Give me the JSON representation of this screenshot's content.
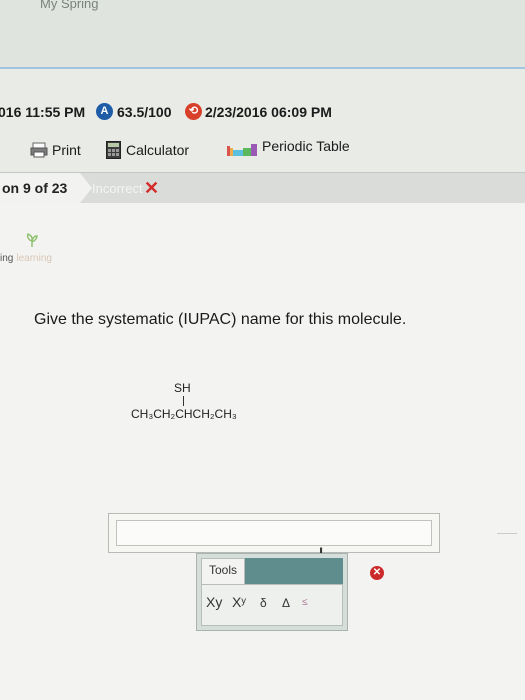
{
  "header": {
    "fragment": "My Spring"
  },
  "status": {
    "due_time": "016 11:55 PM",
    "score_icon": "A",
    "score": "63.5/100",
    "history_icon": "clock-arrow-icon",
    "submitted": "2/23/2016 06:09 PM"
  },
  "toolbar": {
    "print_label": "Print",
    "calculator_label": "Calculator",
    "periodic_label": "Periodic Table"
  },
  "question_bar": {
    "number": "on 9 of 23",
    "status_text": "Incorrect",
    "status_mark": "✕"
  },
  "brand": {
    "part1": "ing",
    "part2": "learning"
  },
  "question": {
    "prompt": "Give the systematic (IUPAC) name for this molecule.",
    "sh_label": "SH",
    "chain": "CH₃CH₂CHCH₂CH₃"
  },
  "answer": {
    "value": ""
  },
  "tools": {
    "tab_label": "Tools",
    "buttons": [
      "Xy",
      "Xʸ",
      "δ",
      "Δ",
      "≤"
    ]
  },
  "colors": {
    "incorrect_x": "#d42a2a",
    "tools_header": "#5f8c8c",
    "score_badge": "#1f5ca8",
    "history_badge": "#d8402a"
  }
}
